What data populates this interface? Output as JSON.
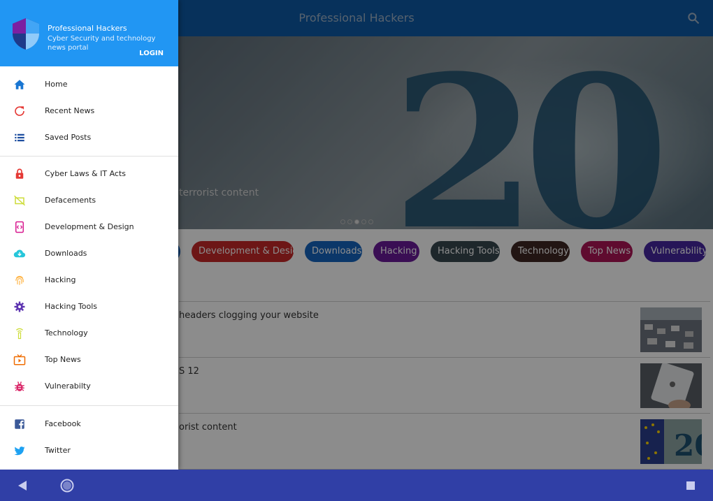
{
  "appbar": {
    "title": "Professional Hackers",
    "search_icon": "search-icon"
  },
  "hero": {
    "caption": "terrorist content",
    "dots_count": 5,
    "active_dot": 2
  },
  "categories": [
    {
      "label": "Development & Design",
      "color": "#c62828"
    },
    {
      "label": "Downloads",
      "color": "#1565c0"
    },
    {
      "label": "Hacking",
      "color": "#6a1b9a"
    },
    {
      "label": "Hacking Tools",
      "color": "#37474f"
    },
    {
      "label": "Technology",
      "color": "#3e2723"
    },
    {
      "label": "Top News",
      "color": "#ad1457"
    },
    {
      "label": "Vulnerability",
      "color": "#4527a0"
    }
  ],
  "news": [
    {
      "headline": "headers clogging your website"
    },
    {
      "headline": "S 12"
    },
    {
      "headline": "orist content"
    }
  ],
  "drawer": {
    "app_name": "Professional Hackers",
    "tagline": "Cyber Security and technology news portal",
    "login": "LOGIN",
    "group1": [
      {
        "label": "Home",
        "icon": "home-icon",
        "color": "#1976d2"
      },
      {
        "label": "Recent News",
        "icon": "refresh-icon",
        "color": "#e53935"
      },
      {
        "label": "Saved Posts",
        "icon": "list-icon",
        "color": "#1e4fa0"
      }
    ],
    "group2": [
      {
        "label": "Cyber Laws & IT Acts",
        "icon": "lock-icon",
        "color": "#e53935"
      },
      {
        "label": "Defacements",
        "icon": "defacement-icon",
        "color": "#cddc39"
      },
      {
        "label": "Development & Design",
        "icon": "code-icon",
        "color": "#d81b90"
      },
      {
        "label": "Downloads",
        "icon": "cloud-download-icon",
        "color": "#26c6da"
      },
      {
        "label": "Hacking",
        "icon": "fingerprint-icon",
        "color": "#ffb74d"
      },
      {
        "label": "Hacking Tools",
        "icon": "gear-icon",
        "color": "#5e35b1"
      },
      {
        "label": "Technology",
        "icon": "signal-tower-icon",
        "color": "#cddc39"
      },
      {
        "label": "Top News",
        "icon": "tv-play-icon",
        "color": "#ef6c00"
      },
      {
        "label": "Vulnerabilty",
        "icon": "bug-icon",
        "color": "#d81b60"
      }
    ],
    "group3": [
      {
        "label": "Facebook",
        "icon": "facebook-icon",
        "color": "#3b5998"
      },
      {
        "label": "Twitter",
        "icon": "twitter-icon",
        "color": "#1da1f2"
      }
    ]
  },
  "sysnav": {
    "back": "back-icon",
    "home": "home-circle-icon",
    "recents": "recents-icon"
  }
}
